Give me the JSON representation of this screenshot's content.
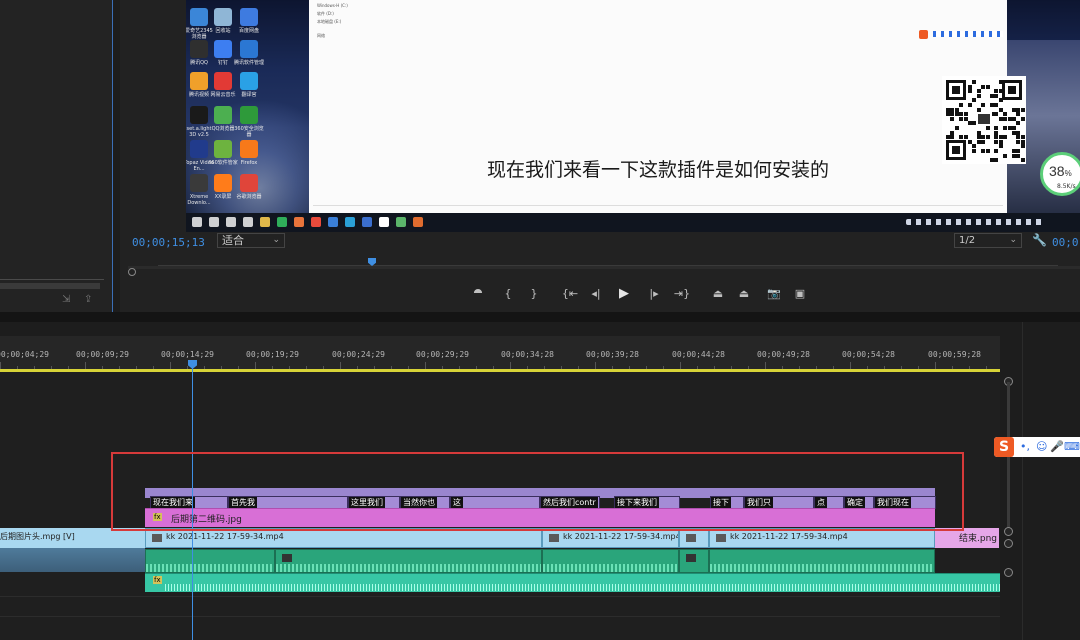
{
  "program_monitor": {
    "timecode": "00;00;15;13",
    "fit_label": "适合",
    "resolution_label": "1/2",
    "timecode_right": "00;0"
  },
  "video_frame": {
    "subtitle": "现在我们来看一下这款插件是如何安装的",
    "explorer_tree": [
      "Windows-H (C:)",
      "软件 (D:)",
      "本地磁盘 (E:)",
      "网络"
    ],
    "speed_percent": "38",
    "speed_percent_unit": "%",
    "speed_rate": "8.5K/s",
    "desktop_icons": [
      {
        "label": "爱奇艺2345浏览器"
      },
      {
        "label": "回收站"
      },
      {
        "label": "百度网盘"
      },
      {
        "label": "腾讯QQ"
      },
      {
        "label": "钉钉"
      },
      {
        "label": "腾讯软件管理"
      },
      {
        "label": "腾讯视频"
      },
      {
        "label": "网易云音乐"
      },
      {
        "label": "翻译官"
      },
      {
        "label": "set.a.light 3D v2.5"
      },
      {
        "label": "QQ浏览器"
      },
      {
        "label": "360安全浏览器"
      },
      {
        "label": "Topaz Video En..."
      },
      {
        "label": "360软件管家"
      },
      {
        "label": "Firefox"
      },
      {
        "label": "Xtreme Downlo..."
      },
      {
        "label": "XX录屏"
      },
      {
        "label": "谷歌浏览器"
      }
    ]
  },
  "transport_controls": [
    {
      "name": "add-marker-button",
      "glyph": "⯊"
    },
    {
      "name": "mark-in-button",
      "glyph": "{"
    },
    {
      "name": "mark-out-button",
      "glyph": "}"
    },
    {
      "name": "go-to-in-button",
      "glyph": "{⇤"
    },
    {
      "name": "step-back-button",
      "glyph": "◂|"
    },
    {
      "name": "play-button",
      "glyph": "▶"
    },
    {
      "name": "step-forward-button",
      "glyph": "|▸"
    },
    {
      "name": "go-to-out-button",
      "glyph": "⇥}"
    },
    {
      "name": "lift-button",
      "glyph": "⏏"
    },
    {
      "name": "extract-button",
      "glyph": "⏏"
    },
    {
      "name": "export-frame-button",
      "glyph": "📷"
    },
    {
      "name": "compare-view-button",
      "glyph": "▣"
    }
  ],
  "timeline": {
    "ruler_labels": [
      "00;00;04;29",
      "00;00;09;29",
      "00;00;14;29",
      "00;00;19;29",
      "00;00;24;29",
      "00;00;29;29",
      "00;00;34;28",
      "00;00;39;28",
      "00;00;44;28",
      "00;00;49;28",
      "00;00;54;28",
      "00;00;59;28"
    ],
    "subtitle_clips": [
      "现在我们来",
      "首先我",
      "这里我们",
      "当然你也",
      "这",
      "然后我们contr",
      "接下来我们",
      "接下",
      "我们只",
      "点",
      "确定",
      "我们现在"
    ],
    "overlay_clip": {
      "fx": "fx",
      "name": "后期第二维码.jpg"
    },
    "left_video_clip": "后期图片头.mpg [V]",
    "video_clips": [
      "kk 2021-11-22 17-59-34.mp4",
      "kk 2021-11-22 17-59-34.mp4",
      "kk 2021-11-22 17-59-34.mp4"
    ],
    "end_clip": "结束.png",
    "music_fx": "fx"
  },
  "ime_toolbar": {
    "logo": "S"
  },
  "colors": {
    "accent_blue": "#3f8fe3",
    "highlight_red": "#d63a3a",
    "subtitle_purple": "#a48cd6",
    "overlay_pink": "#d86fd6",
    "video_blue": "#a9d8f0",
    "audio_green": "#2aa57b",
    "music_teal": "#37c7a5",
    "work_area_yellow": "#d7d337"
  }
}
